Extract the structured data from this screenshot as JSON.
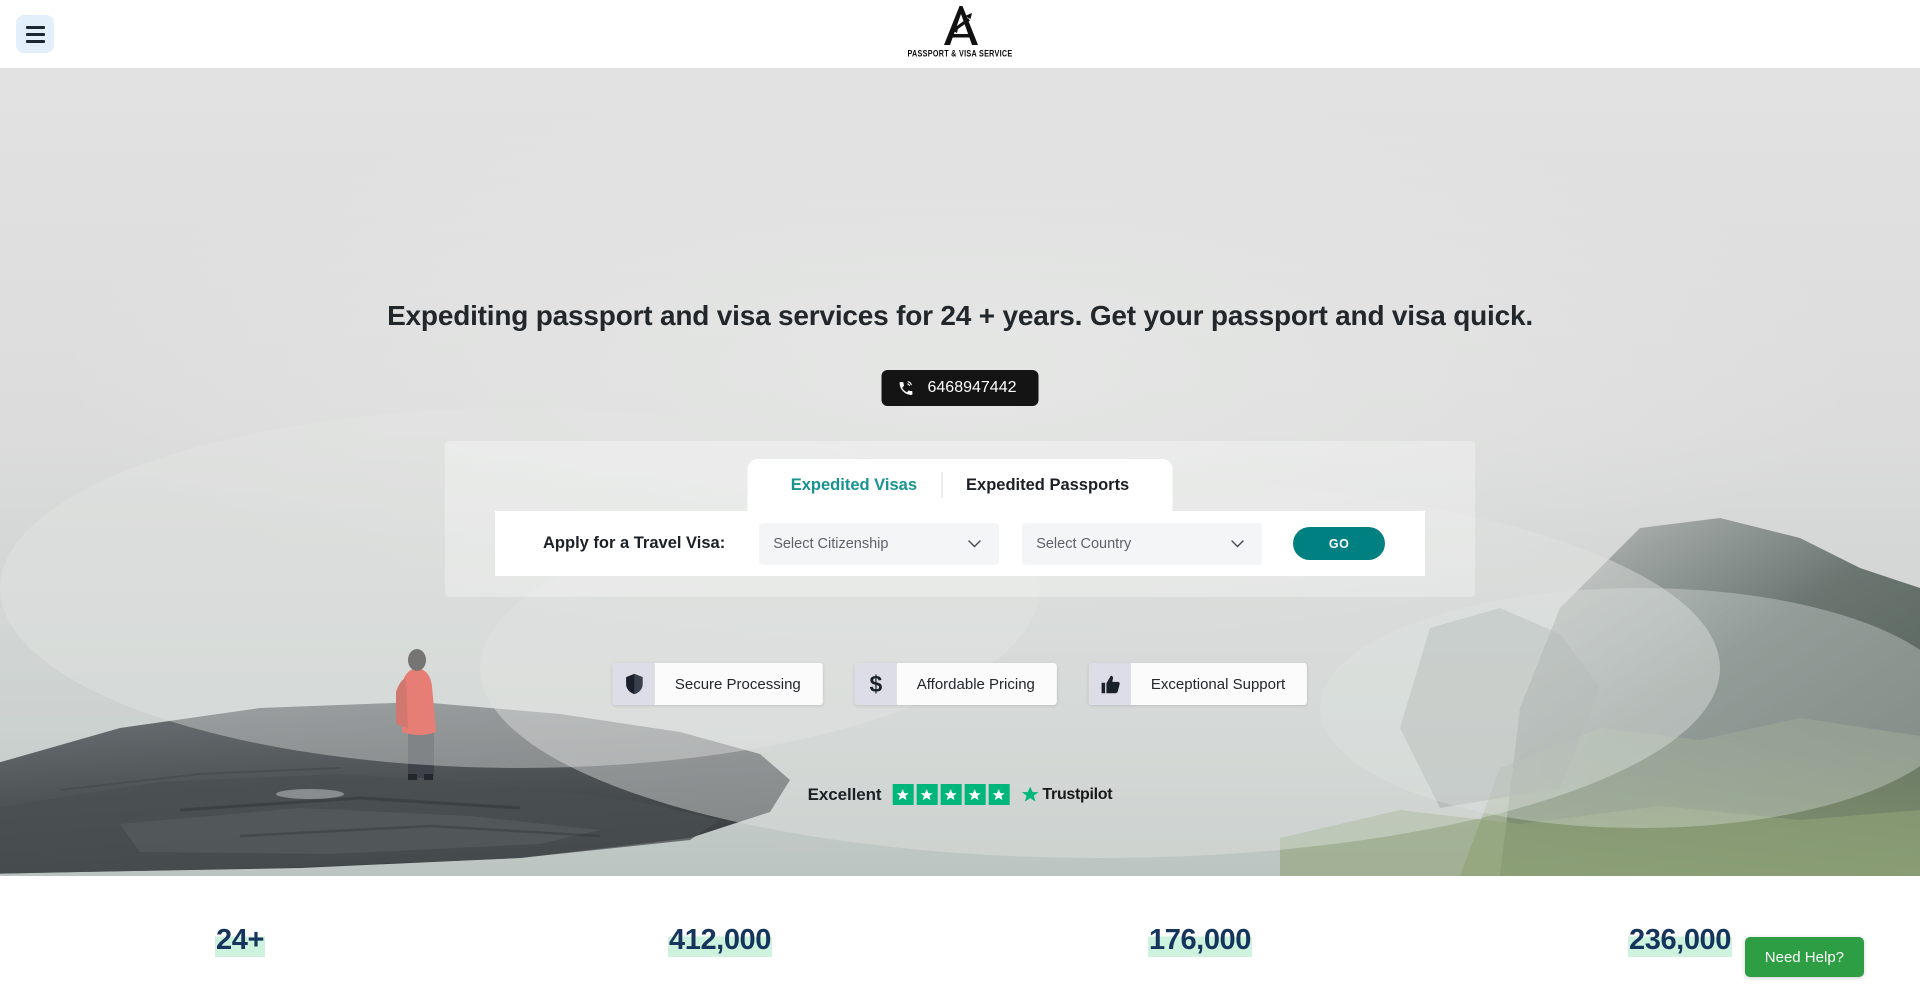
{
  "header": {
    "menu_icon": "hamburger-menu-icon",
    "logo_letter": "A",
    "logo_tagline": "PASSPORT & VISA SERVICE"
  },
  "hero": {
    "headline": "Expediting passport and visa services for 24 + years. Get your passport and visa quick.",
    "phone": {
      "icon": "ringing-phone-icon",
      "number": "6468947442"
    },
    "background_description": "Person in a red jacket standing on a foggy rock cliff overlooking a misty fjord"
  },
  "search_panel": {
    "tabs": [
      {
        "label": "Expedited Visas",
        "active": true
      },
      {
        "label": "Expedited Passports",
        "active": false
      }
    ],
    "form": {
      "label": "Apply for a Travel Visa:",
      "citizenship_placeholder": "Select Citizenship",
      "country_placeholder": "Select Country",
      "submit_label": "GO"
    }
  },
  "badges": [
    {
      "icon": "shield-icon",
      "label": "Secure Processing"
    },
    {
      "icon": "dollar-sign-icon",
      "label": "Affordable Pricing"
    },
    {
      "icon": "thumbs-up-icon",
      "label": "Exceptional Support"
    }
  ],
  "trustpilot": {
    "rating_word": "Excellent",
    "stars": 5,
    "brand": "Trustpilot",
    "star_color": "#00b67a"
  },
  "stats": [
    {
      "value": "24+"
    },
    {
      "value": "412,000"
    },
    {
      "value": "176,000"
    },
    {
      "value": "236,000"
    }
  ],
  "support": {
    "need_help_label": "Need Help?"
  },
  "colors": {
    "accent_teal": "#008080",
    "tab_active": "#17948f",
    "stat_text": "#16355c",
    "stat_highlight": "#cdf2dd",
    "need_help_green": "#2d9e43",
    "trustpilot_green": "#00b67a",
    "phone_button": "#141414"
  }
}
